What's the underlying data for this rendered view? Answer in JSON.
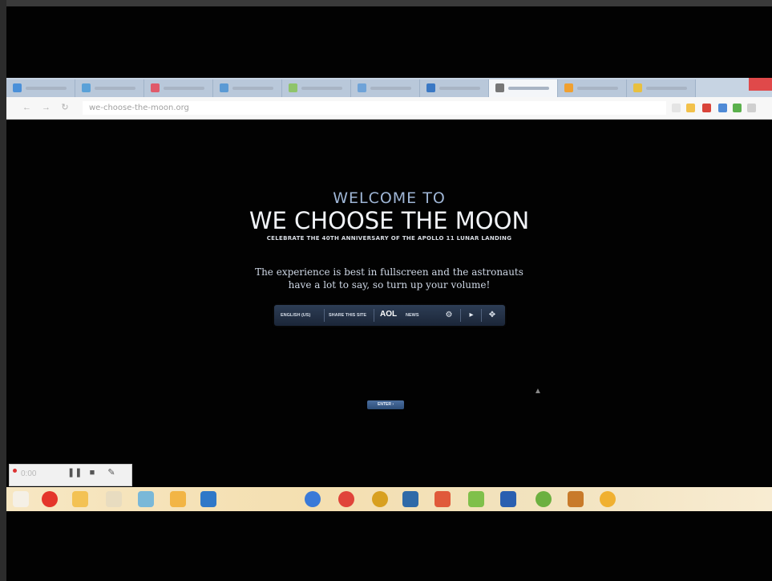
{
  "browser": {
    "tabs": [
      {
        "favicon_color": "#4a90d9"
      },
      {
        "favicon_color": "#5aa1d8"
      },
      {
        "favicon_color": "#e05a6a"
      },
      {
        "favicon_color": "#5b9ad4"
      },
      {
        "favicon_color": "#8fc46a"
      },
      {
        "favicon_color": "#6fa3d8"
      },
      {
        "favicon_color": "#3a78c4"
      },
      {
        "favicon_color": "#777777",
        "active": true
      },
      {
        "favicon_color": "#f0a030"
      },
      {
        "favicon_color": "#e8c040"
      }
    ],
    "url": "we-choose-the-moon.org",
    "back_icon": "back-arrow-icon",
    "forward_icon": "forward-arrow-icon",
    "reload_icon": "reload-icon"
  },
  "page": {
    "welcome_line": "WELCOME TO",
    "title": "WE CHOOSE THE MOON",
    "subtitle": "CELEBRATE THE 40TH ANNIVERSARY OF THE APOLLO 11 LUNAR LANDING",
    "intro_line1": "The experience is best in fullscreen and the astronauts",
    "intro_line2": "have a lot to say, so turn up your volume!",
    "controls": {
      "item1": "ENGLISH (US)",
      "item2": "SHARE THIS SITE",
      "aol": "AOL",
      "aol_sub": "NEWS",
      "settings_icon": "gear-icon",
      "volume_icon": "speaker-icon",
      "fullscreen_icon": "fullscreen-icon"
    },
    "enter_button": "ENTER ›"
  },
  "recorder": {
    "time": "0:00",
    "pause_icon": "pause-icon",
    "stop_icon": "stop-icon",
    "draw_icon": "pencil-icon"
  },
  "taskbar": {
    "icons": [
      {
        "name": "explorer-icon",
        "color": "#f5f0e6"
      },
      {
        "name": "opera-icon",
        "color": "#e4352a"
      },
      {
        "name": "folder-icon",
        "color": "#f3c254"
      },
      {
        "name": "paint-icon",
        "color": "#e8dcc0"
      },
      {
        "name": "network-icon",
        "color": "#7ab8d8"
      },
      {
        "name": "app-icon",
        "color": "#f2b545"
      },
      {
        "name": "outlook-icon",
        "color": "#2f78c8"
      },
      {
        "name": "firefox-icon",
        "color": "#3a7ad8"
      },
      {
        "name": "chrome-icon",
        "color": "#e0443a"
      },
      {
        "name": "chrome-icon-2",
        "color": "#d8a020"
      },
      {
        "name": "bird-icon",
        "color": "#2f6aa8"
      },
      {
        "name": "gallery-icon",
        "color": "#e05a3a"
      },
      {
        "name": "window-icon",
        "color": "#7fc04a"
      },
      {
        "name": "word-icon",
        "color": "#2a5fb0"
      },
      {
        "name": "green-app-icon",
        "color": "#6cb040"
      },
      {
        "name": "tool-icon",
        "color": "#c87a2a"
      },
      {
        "name": "smile-icon",
        "color": "#f0b030"
      }
    ]
  }
}
